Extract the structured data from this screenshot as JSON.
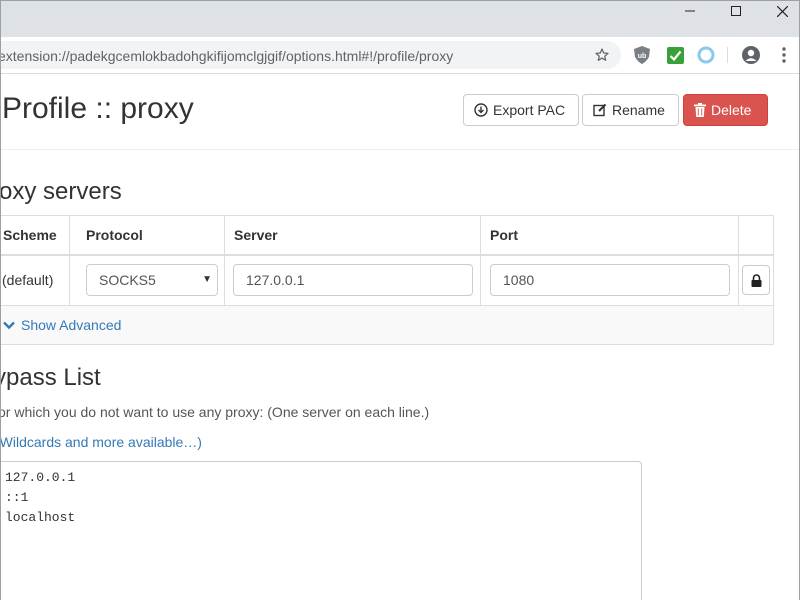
{
  "browser": {
    "url": "extension://padekgcemlokbadohgkifijomclgjgif/options.html#!/profile/proxy",
    "window_controls": [
      "minimize",
      "maximize",
      "close"
    ],
    "extensions": [
      "ublock-origin-icon",
      "green-check-extension-icon",
      "switchyomega-circle-icon"
    ],
    "toolbar_icons": [
      "bookmark-star-icon",
      "profile-avatar-icon",
      "kebab-menu-icon"
    ]
  },
  "header": {
    "title": "Profile :: proxy",
    "export_pac": "Export PAC",
    "rename": "Rename",
    "delete": "Delete",
    "delete_color": "#d9534f"
  },
  "servers": {
    "title": "Proxy servers",
    "columns": {
      "scheme": "Scheme",
      "protocol": "Protocol",
      "server": "Server",
      "port": "Port"
    },
    "row": {
      "scheme": "(default)",
      "protocol": "SOCKS5",
      "server": "127.0.0.1",
      "port": "1080"
    },
    "show_advanced": "Show Advanced"
  },
  "bypass": {
    "title": "Bypass List",
    "help": "Servers for which you do not want to use any proxy: (One server on each line.)",
    "wildcards_link": "(Wildcards and more available…)",
    "lines": [
      "127.0.0.1",
      "::1",
      "localhost"
    ]
  },
  "colors": {
    "link": "#337ab7",
    "titlebar": "#dee1e6"
  }
}
